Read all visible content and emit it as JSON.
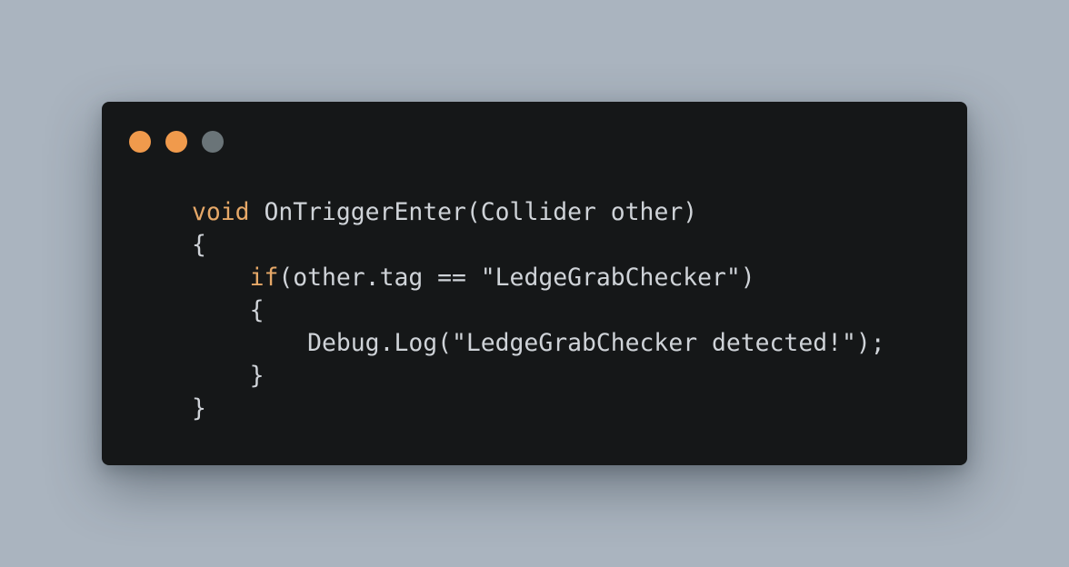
{
  "colors": {
    "background": "#aab4bf",
    "window": "#151718",
    "keyword": "#e6a868",
    "text": "#cfd3d8"
  },
  "window_controls": [
    {
      "name": "close",
      "color": "#f09a4c"
    },
    {
      "name": "minimize",
      "color": "#f09a4c"
    },
    {
      "name": "maximize",
      "color": "#6a7478"
    }
  ],
  "code": {
    "line1": {
      "indent": "    ",
      "kw": "void",
      "rest": " OnTriggerEnter(Collider other)"
    },
    "line2": {
      "indent": "    ",
      "text": "{"
    },
    "line3": {
      "indent": "        ",
      "kw": "if",
      "rest": "(other.tag == \"LedgeGrabChecker\")"
    },
    "line4": {
      "indent": "        ",
      "text": "{"
    },
    "line5": {
      "indent": "            ",
      "text": "Debug.Log(\"LedgeGrabChecker detected!\");"
    },
    "line6": {
      "indent": "        ",
      "text": "}"
    },
    "line7": {
      "indent": "    ",
      "text": "}"
    }
  }
}
